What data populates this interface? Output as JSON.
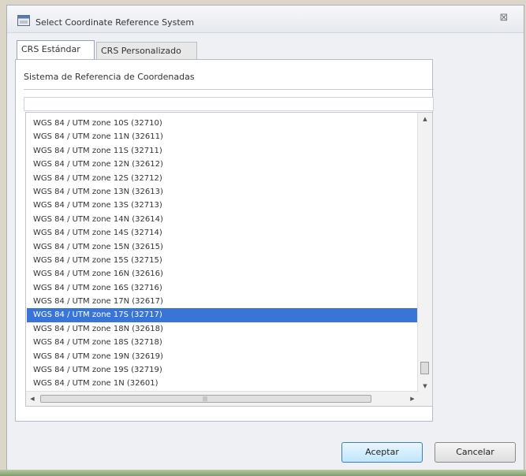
{
  "window": {
    "title": "Select Coordinate Reference System",
    "close_glyph": "⊠",
    "app_icon": "window-icon"
  },
  "tabs": [
    {
      "label": "CRS Estándar",
      "active": true
    },
    {
      "label": "CRS Personalizado",
      "active": false
    }
  ],
  "panel": {
    "label": "Sistema de Referencia de Coordenadas",
    "search_value": ""
  },
  "crs_list": [
    {
      "label": "WGS 84 / UTM zone 10S (32710)"
    },
    {
      "label": "WGS 84 / UTM zone 11N (32611)"
    },
    {
      "label": "WGS 84 / UTM zone 11S (32711)"
    },
    {
      "label": "WGS 84 / UTM zone 12N (32612)"
    },
    {
      "label": "WGS 84 / UTM zone 12S (32712)"
    },
    {
      "label": "WGS 84 / UTM zone 13N (32613)"
    },
    {
      "label": "WGS 84 / UTM zone 13S (32713)"
    },
    {
      "label": "WGS 84 / UTM zone 14N (32614)"
    },
    {
      "label": "WGS 84 / UTM zone 14S (32714)"
    },
    {
      "label": "WGS 84 / UTM zone 15N (32615)"
    },
    {
      "label": "WGS 84 / UTM zone 15S (32715)"
    },
    {
      "label": "WGS 84 / UTM zone 16N (32616)"
    },
    {
      "label": "WGS 84 / UTM zone 16S (32716)"
    },
    {
      "label": "WGS 84 / UTM zone 17N (32617)"
    },
    {
      "label": "WGS 84 / UTM zone 17S (32717)"
    },
    {
      "label": "WGS 84 / UTM zone 18N (32618)"
    },
    {
      "label": "WGS 84 / UTM zone 18S (32718)"
    },
    {
      "label": "WGS 84 / UTM zone 19N (32619)"
    },
    {
      "label": "WGS 84 / UTM zone 19S (32719)"
    },
    {
      "label": "WGS 84 / UTM zone 1N (32601)"
    }
  ],
  "selected_item": "WGS 84 / UTM zone 17S (32717)",
  "buttons": {
    "accept": "Aceptar",
    "cancel": "Cancelar"
  },
  "colors": {
    "selection": "#3875d7",
    "accept_border": "#3c7fb1"
  }
}
